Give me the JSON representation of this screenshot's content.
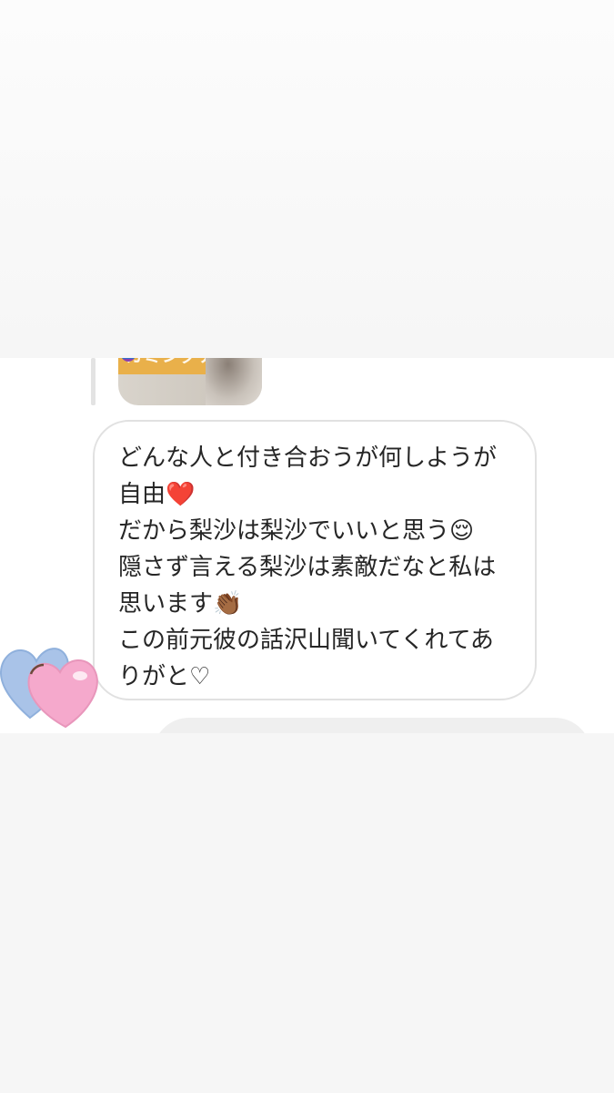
{
  "story_reply": {
    "sticker_text": "カミングアウト"
  },
  "message": {
    "lines": [
      "どんな人と付き合おうが何しようが",
      "自由❤️",
      "だから梨沙は梨沙でいいと思う😌",
      "隠さず言える梨沙は素敵だなと私は",
      "思います👏🏾",
      "この前元彼の話沢山聞いてくれてあ",
      "りがと♡"
    ]
  },
  "stickers": {
    "hearts": [
      "heart-blue",
      "heart-pink"
    ],
    "colors": {
      "blue": "#a9c3e8",
      "pink": "#f5a9cc"
    }
  },
  "colors": {
    "sticker_bg": "#e9b04a",
    "bubble_border": "#e1e1e1",
    "text": "#262626"
  }
}
